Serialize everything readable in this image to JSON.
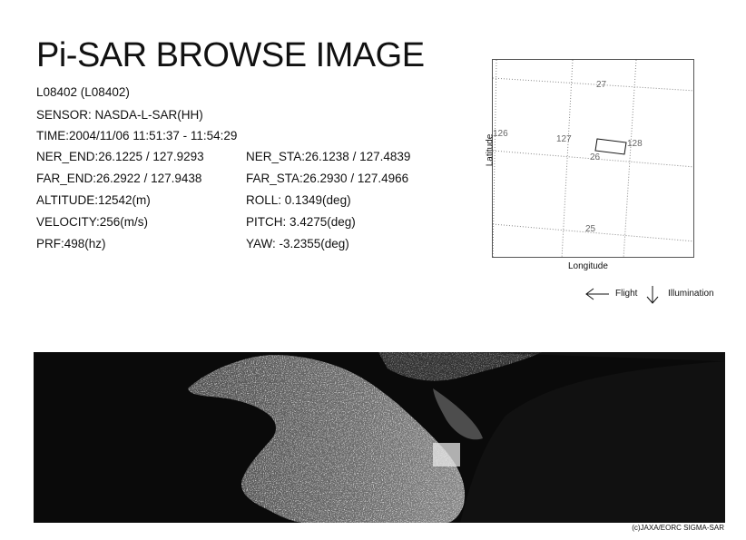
{
  "header": {
    "title": "Pi-SAR BROWSE IMAGE",
    "scene_id": "L08402 (L08402)",
    "sensor": "SENSOR: NASDA-L-SAR(HH)",
    "time": "TIME:2004/11/06  11:51:37 - 11:54:29"
  },
  "params_left": [
    "NER_END:26.1225 / 127.9293",
    "FAR_END:26.2922 / 127.9438",
    "ALTITUDE:12542(m)",
    "VELOCITY:256(m/s)",
    "PRF:498(hz)"
  ],
  "params_right": [
    "NER_STA:26.1238 / 127.4839",
    "FAR_STA:26.2930 / 127.4966",
    "ROLL: 0.1349(deg)",
    "PITCH:  3.4275(deg)",
    "YAW:  -3.2355(deg)"
  ],
  "map": {
    "lat_labels": [
      "27",
      "26",
      "25"
    ],
    "lon_labels": [
      "126",
      "127",
      "128"
    ],
    "x_axis_label": "Longitude",
    "y_axis_label": "Latitude"
  },
  "legend": {
    "flight_label": "Flight",
    "illumination_label": "Illumination"
  },
  "credit": "(c)JAXA/EORC SIGMA-SAR",
  "colors": {
    "background": "#ffffff",
    "grid": "#888888",
    "sar_background": "#0a0a0a"
  }
}
